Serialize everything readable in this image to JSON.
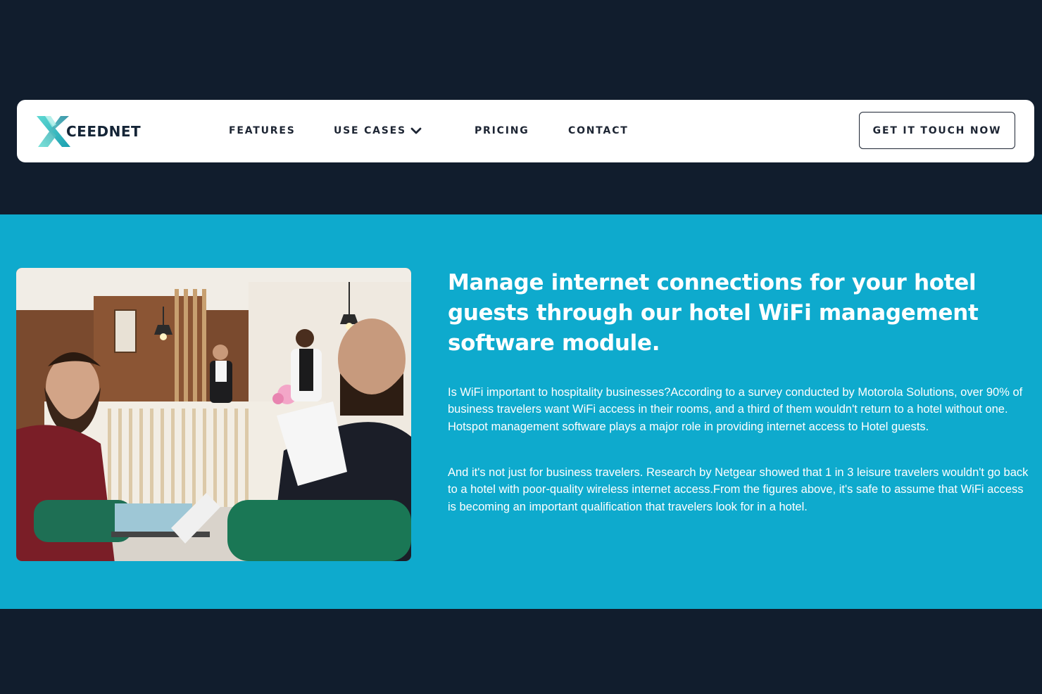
{
  "brand": {
    "logo_text": "CEEDNET",
    "logo_mark_letter": "X"
  },
  "nav": {
    "items": [
      {
        "label": "FEATURES"
      },
      {
        "label": "USE CASES"
      },
      {
        "label": "PRICING"
      },
      {
        "label": "CONTACT"
      }
    ],
    "cta_label": "GET IT TOUCH NOW"
  },
  "hero": {
    "heading": "Manage internet connections for your hotel guests through our hotel WiFi management software module.",
    "paragraphs": [
      "Is WiFi important to hospitality businesses?According to a survey conducted by Motorola Solutions, over 90% of business travelers want WiFi access in their rooms, and a third of them wouldn't return to a hotel without one. Hotspot management software plays a major role in providing internet access to Hotel guests.",
      "And it's not just for business travelers. Research by Netgear showed that 1 in 3 leisure travelers wouldn't go back to a hotel with poor-quality wireless internet access.From the figures above, it's safe to assume that WiFi access is becoming an important qualification that travelers look for in a hotel."
    ]
  },
  "colors": {
    "page_background": "#111d2d",
    "hero_background": "#0eaacd",
    "nav_background": "#ffffff",
    "nav_text": "#1d2533",
    "logo_teal": "#3ec6c4"
  },
  "icons": {
    "use_cases_dropdown": "chevron-down-icon",
    "logo": "xceednet-logo-icon"
  }
}
